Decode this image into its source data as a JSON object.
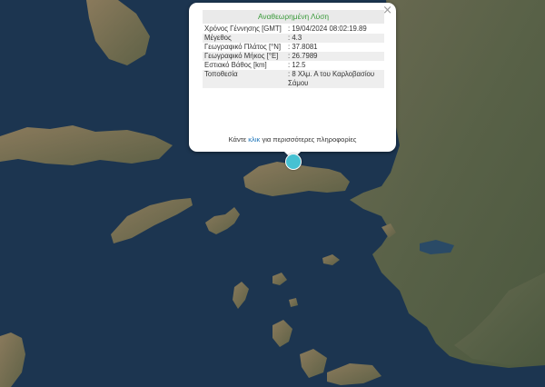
{
  "popup": {
    "title": "Αναθεωρημένη Λύση",
    "rows": [
      {
        "label": "Χρόνος Γέννησης [GMT]",
        "value": ": 19/04/2024 08:02:19.89"
      },
      {
        "label": "Μέγεθος",
        "value": ": 4.3"
      },
      {
        "label": "Γεωγραφικό Πλάτος [°N]",
        "value": ": 37.8081"
      },
      {
        "label": "Γεωγραφικό Μήκος [°E]",
        "value": ": 26.7989"
      },
      {
        "label": "Εστιακό Βάθος [km]",
        "value": ": 12.5"
      },
      {
        "label": "Τοποθεσία",
        "value": ": 8 Χλμ. Α του Καρλοβασίου Σάμου"
      }
    ],
    "more_prefix": "Κάντε",
    "more_link": "κλικ",
    "more_suffix": "για περισσότερες πληροφορίες",
    "close_symbol": "×"
  },
  "map": {
    "water_color": "#1c3550",
    "land_color": "#56604a",
    "marker_color": "#46c1d2"
  }
}
